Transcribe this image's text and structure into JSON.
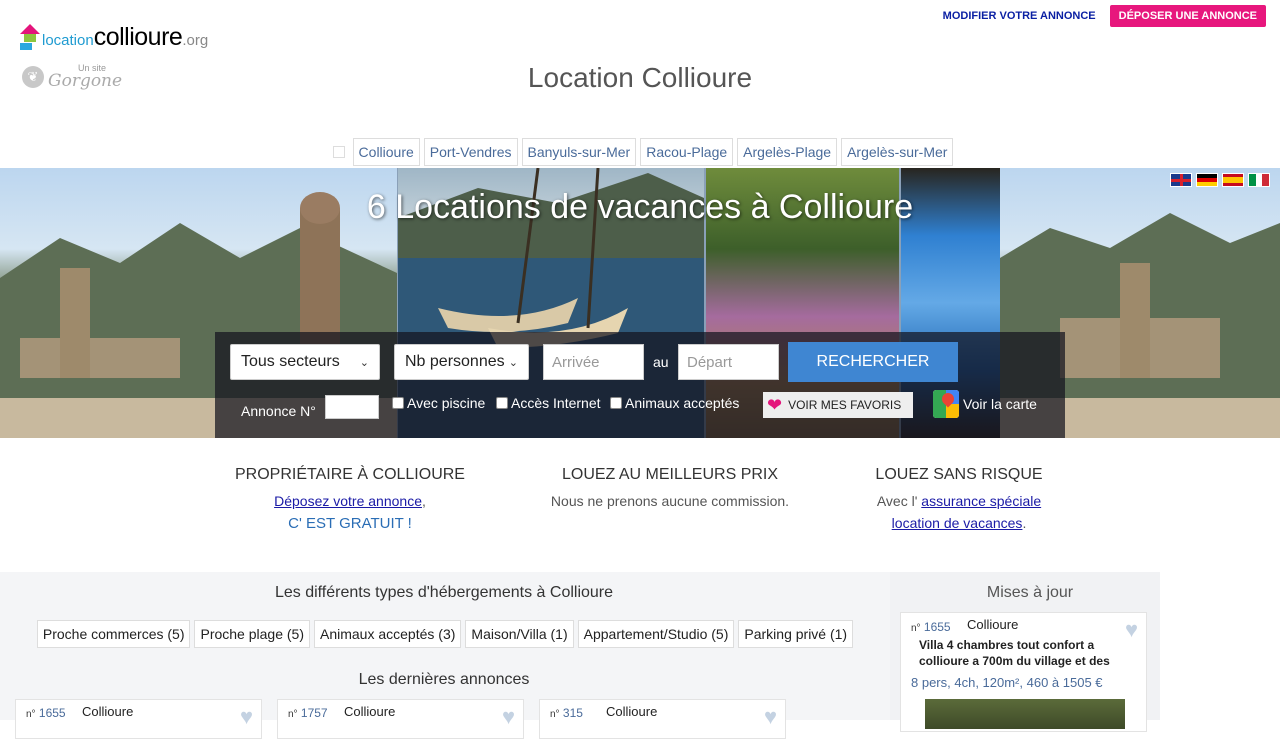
{
  "header": {
    "logo": {
      "part1": "location",
      "part2": "collioure",
      "part3": ".org"
    },
    "gorgone": {
      "small": "Un site",
      "big": "Gorgone"
    },
    "modify_link": "MODIFIER VOTRE ANNONCE",
    "deposit_button": "DÉPOSER UNE ANNONCE",
    "page_title": "Location Collioure"
  },
  "city_tabs": [
    "Collioure",
    "Port-Vendres",
    "Banyuls-sur-Mer",
    "Racou-Plage",
    "Argelès-Plage",
    "Argelès-sur-Mer"
  ],
  "banner": {
    "title": "6 Locations de vacances à Collioure",
    "flags": [
      "uk-flag-icon",
      "de-flag-icon",
      "es-flag-icon",
      "it-flag-icon"
    ]
  },
  "search": {
    "sector_select": "Tous secteurs",
    "persons_select": "Nb personnes",
    "arrival_placeholder": "Arrivée",
    "au": "au",
    "departure_placeholder": "Départ",
    "search_button": "RECHERCHER",
    "annonce_label": "Annonce N°",
    "checks": [
      "Avec piscine",
      "Accès Internet",
      "Animaux acceptés"
    ],
    "favorites_button": "VOIR MES FAVORIS",
    "map_link": "Voir la carte"
  },
  "features": {
    "owner": {
      "title": "PROPRIÉTAIRE À COLLIOURE",
      "link": "Déposez votre annonce",
      "comma": ",",
      "free": "C' EST GRATUIT !"
    },
    "price": {
      "title": "LOUEZ AU MEILLEURS PRIX",
      "text": "Nous ne prenons aucune commission."
    },
    "safe": {
      "title": "LOUEZ SANS RISQUE",
      "prefix": "Avec l'",
      "link1": "assurance spéciale",
      "link2": "location de vacances",
      "suffix": "."
    }
  },
  "types_section": {
    "title": "Les différents types d'hébergements à Collioure",
    "chips": [
      "Proche commerces (5)",
      "Proche plage (5)",
      "Animaux acceptés (3)",
      "Maison/Villa (1)",
      "Appartement/Studio (5)",
      "Parking privé (1)"
    ]
  },
  "latest_section": {
    "title": "Les dernières annonces",
    "ads": [
      {
        "num_prefix": "n°",
        "num": "1655",
        "city": "Collioure"
      },
      {
        "num_prefix": "n°",
        "num": "1757",
        "city": "Collioure"
      },
      {
        "num_prefix": "n°",
        "num": "315",
        "city": "Collioure"
      }
    ]
  },
  "updates": {
    "title": "Mises à jour",
    "card": {
      "num_prefix": "n°",
      "num": "1655",
      "city": "Collioure",
      "desc": "Villa 4 chambres tout confort a collioure a 700m du village et des",
      "meta": "8 pers, 4ch, 120m², 460 à 1505 €"
    }
  },
  "colors": {
    "brand_pink": "#e7177d",
    "search_blue": "#3f86d2",
    "link_blue": "#1a1aa6",
    "logo_blue": "#1f9bd1"
  }
}
